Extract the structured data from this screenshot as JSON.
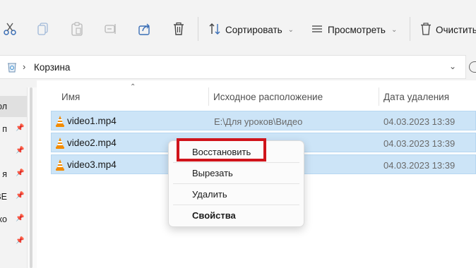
{
  "toolbar": {
    "icons": [
      "cut-icon",
      "copy-icon",
      "paste-icon",
      "rename-icon",
      "share-icon",
      "delete-icon"
    ],
    "sort_label": "Сортировать",
    "view_label": "Просмотреть",
    "empty_label": "Очистить"
  },
  "address": {
    "path": "Корзина"
  },
  "nav": {
    "items": [
      {
        "label": "ол",
        "pinned": false
      },
      {
        "label": "п",
        "pinned": true
      },
      {
        "label": "",
        "pinned": true
      },
      {
        "label": "я",
        "pinned": true
      },
      {
        "label": "BE",
        "pinned": true
      },
      {
        "label": "око",
        "pinned": true
      },
      {
        "label": "",
        "pinned": true
      }
    ]
  },
  "columns": {
    "name": "Имя",
    "origin": "Исходное расположение",
    "deleted": "Дата удаления"
  },
  "files": [
    {
      "name": "video1.mp4",
      "origin": "E:\\Для уроков\\Видео",
      "deleted": "04.03.2023 13:39"
    },
    {
      "name": "video2.mp4",
      "origin": "",
      "deleted": "04.03.2023 13:39"
    },
    {
      "name": "video3.mp4",
      "origin": "",
      "deleted": "04.03.2023 13:39"
    }
  ],
  "context_menu": {
    "items": [
      "Восстановить",
      "Вырезать",
      "Удалить",
      "Свойства"
    ]
  },
  "colors": {
    "selection": "#cce4f7",
    "highlight": "#d0141b",
    "vlc_orange": "#f28b00"
  }
}
